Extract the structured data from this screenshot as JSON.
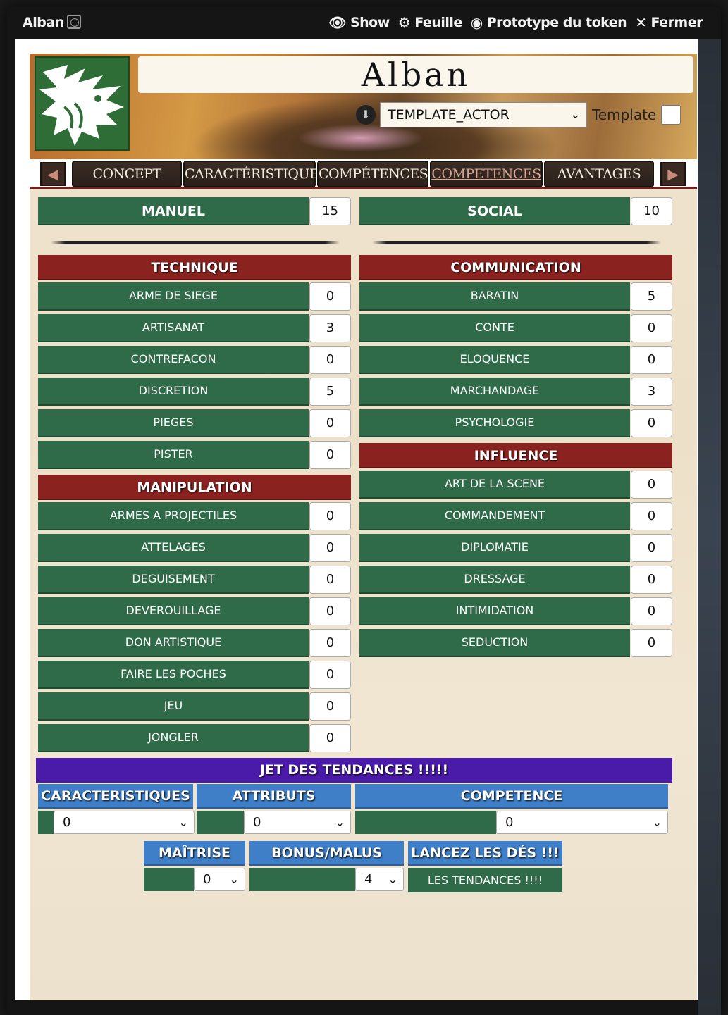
{
  "window": {
    "title": "Alban",
    "controls": [
      {
        "label": "Show",
        "icon": "eye-icon"
      },
      {
        "label": "Feuille",
        "icon": "gear-icon"
      },
      {
        "label": "Prototype du token",
        "icon": "user-circle-icon"
      },
      {
        "label": "Fermer",
        "icon": "close-icon"
      }
    ]
  },
  "header": {
    "name": "Alban",
    "template_select": "TEMPLATE_ACTOR",
    "template_label": "Template"
  },
  "tabs": [
    {
      "label": "CONCEPT"
    },
    {
      "label": "CARACTÉRISTIQUE"
    },
    {
      "label": "COMPÉTENCES"
    },
    {
      "label": "COMPETENCES"
    },
    {
      "label": "AVANTAGES"
    }
  ],
  "active_tab": "COMPETENCES",
  "stats": {
    "manuel": {
      "label": "MANUEL",
      "value": "15"
    },
    "social": {
      "label": "SOCIAL",
      "value": "10"
    }
  },
  "categories": {
    "technique": {
      "label": "TECHNIQUE",
      "skills": [
        {
          "label": "ARME DE SIEGE",
          "value": "0"
        },
        {
          "label": "ARTISANAT",
          "value": "3"
        },
        {
          "label": "CONTREFACON",
          "value": "0"
        },
        {
          "label": "DISCRETION",
          "value": "5"
        },
        {
          "label": "PIEGES",
          "value": "0"
        },
        {
          "label": "PISTER",
          "value": "0"
        }
      ]
    },
    "manipulation": {
      "label": "MANIPULATION",
      "skills": [
        {
          "label": "ARMES A PROJECTILES",
          "value": "0"
        },
        {
          "label": "ATTELAGES",
          "value": "0"
        },
        {
          "label": "DEGUISEMENT",
          "value": "0"
        },
        {
          "label": "DEVEROUILLAGE",
          "value": "0"
        },
        {
          "label": "DON ARTISTIQUE",
          "value": "0"
        },
        {
          "label": "FAIRE LES POCHES",
          "value": "0"
        },
        {
          "label": "JEU",
          "value": "0"
        },
        {
          "label": "JONGLER",
          "value": "0"
        }
      ]
    },
    "communication": {
      "label": "COMMUNICATION",
      "skills": [
        {
          "label": "BARATIN",
          "value": "5"
        },
        {
          "label": "CONTE",
          "value": "0"
        },
        {
          "label": "ELOQUENCE",
          "value": "0"
        },
        {
          "label": "MARCHANDAGE",
          "value": "3"
        },
        {
          "label": "PSYCHOLOGIE",
          "value": "0"
        }
      ]
    },
    "influence": {
      "label": "INFLUENCE",
      "skills": [
        {
          "label": "ART DE LA SCENE",
          "value": "0"
        },
        {
          "label": "COMMANDEMENT",
          "value": "0"
        },
        {
          "label": "DIPLOMATIE",
          "value": "0"
        },
        {
          "label": "DRESSAGE",
          "value": "0"
        },
        {
          "label": "INTIMIDATION",
          "value": "0"
        },
        {
          "label": "SEDUCTION",
          "value": "0"
        }
      ]
    }
  },
  "roll": {
    "title": "JET DES TENDANCES !!!!!",
    "caracteristiques": {
      "label": "CARACTERISTIQUES",
      "value": "0"
    },
    "attributs": {
      "label": "ATTRIBUTS",
      "value": "0"
    },
    "competence": {
      "label": "COMPETENCE",
      "value": "0"
    },
    "maitrise": {
      "label": "MAÎTRISE",
      "value": "0"
    },
    "bonus": {
      "label": "BONUS/MALUS",
      "value": "4"
    },
    "lancez": {
      "label": "LANCEZ LES DÉS !!!"
    },
    "button": "LES TENDANCES !!!!"
  },
  "colors": {
    "green": "#2f6b48",
    "red": "#8a2320",
    "purple": "#4a1aa8",
    "blue": "#3f7fc8"
  }
}
